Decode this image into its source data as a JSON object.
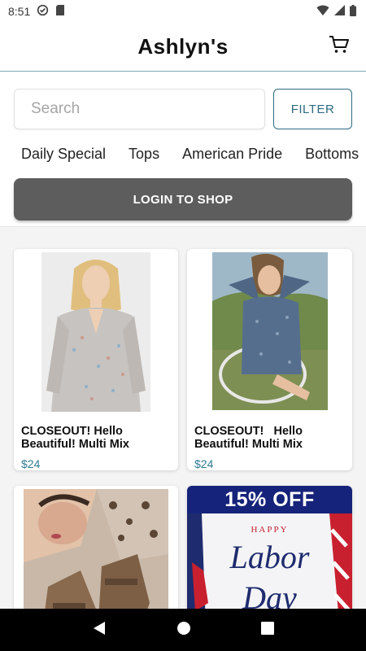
{
  "status_bar": {
    "time": "8:51"
  },
  "header": {
    "title": "Ashlyn's"
  },
  "search": {
    "placeholder": "Search",
    "filter_label": "FILTER"
  },
  "categories": [
    "Daily Special",
    "Tops",
    "American Pride",
    "Bottoms"
  ],
  "login_button": {
    "label": "LOGIN TO SHOP"
  },
  "products": [
    {
      "name": "CLOSEOUT! Hello Beautiful! Multi Mix",
      "price": "$24"
    },
    {
      "name": "CLOSEOUT!   Hello Beautiful! Multi Mix",
      "price": "$24"
    }
  ],
  "promo": {
    "discount_text": "15% OFF",
    "top_word": "HAPPY",
    "line1": "Labor",
    "line2": "Day"
  },
  "icons": [
    "sync-icon",
    "sd-card-icon",
    "wifi-icon",
    "signal-icon",
    "battery-icon",
    "cart-icon",
    "back-icon",
    "home-icon",
    "recents-icon"
  ],
  "colors": {
    "accent": "#2e6a80",
    "price": "#2e7a93",
    "login_button_bg": "#5d5d5d",
    "nav_bg": "#000000"
  }
}
